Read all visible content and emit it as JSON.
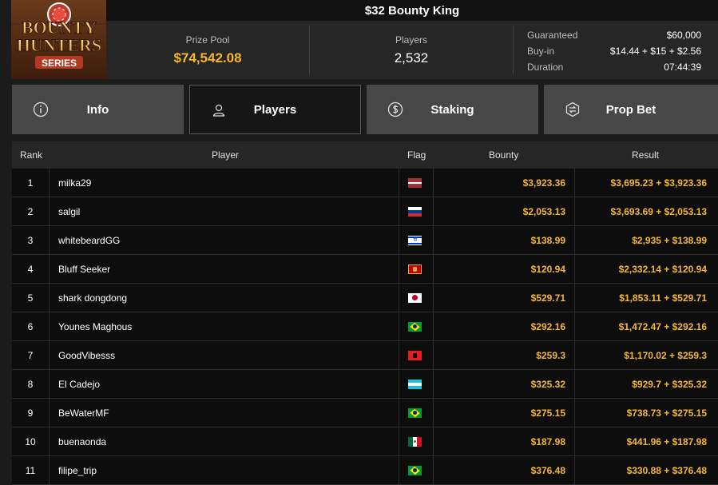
{
  "logo": {
    "line1": "BOUNTY",
    "line2": "HUNTERS",
    "line3": "SERIES"
  },
  "title": "$32 Bounty King",
  "stats": {
    "prize_pool_label": "Prize Pool",
    "prize_pool_value": "$74,542.08",
    "players_label": "Players",
    "players_value": "2,532"
  },
  "details": {
    "guaranteed_label": "Guaranteed",
    "guaranteed_value": "$60,000",
    "buyin_label": "Buy-in",
    "buyin_value": "$14.44 + $15 + $2.56",
    "duration_label": "Duration",
    "duration_value": "07:44:39"
  },
  "tabs": [
    {
      "label": "Info",
      "icon": "info-icon"
    },
    {
      "label": "Players",
      "icon": "user-icon"
    },
    {
      "label": "Staking",
      "icon": "dollar-coin-icon"
    },
    {
      "label": "Prop Bet",
      "icon": "prop-bet-icon"
    }
  ],
  "table": {
    "headers": {
      "rank": "Rank",
      "player": "Player",
      "flag": "Flag",
      "bounty": "Bounty",
      "result": "Result"
    },
    "rows": [
      {
        "rank": "1",
        "player": "milka29",
        "flag": "latvia",
        "bounty": "$3,923.36",
        "result": "$3,695.23 + $3,923.36"
      },
      {
        "rank": "2",
        "player": "salgil",
        "flag": "russia",
        "bounty": "$2,053.13",
        "result": "$3,693.69 + $2,053.13"
      },
      {
        "rank": "3",
        "player": "whitebeardGG",
        "flag": "israel",
        "bounty": "$138.99",
        "result": "$2,935 + $138.99"
      },
      {
        "rank": "4",
        "player": "Bluff Seeker",
        "flag": "montenegro",
        "bounty": "$120.94",
        "result": "$2,332.14 + $120.94"
      },
      {
        "rank": "5",
        "player": "shark dongdong",
        "flag": "japan",
        "bounty": "$529.71",
        "result": "$1,853.11 + $529.71"
      },
      {
        "rank": "6",
        "player": "Younes Maghous",
        "flag": "brazil",
        "bounty": "$292.16",
        "result": "$1,472.47 + $292.16"
      },
      {
        "rank": "7",
        "player": "GoodVibesss",
        "flag": "albania",
        "bounty": "$259.3",
        "result": "$1,170.02 + $259.3"
      },
      {
        "rank": "8",
        "player": "El Cadejo",
        "flag": "honduras",
        "bounty": "$325.32",
        "result": "$929.7 + $325.32"
      },
      {
        "rank": "9",
        "player": "BeWaterMF",
        "flag": "brazil",
        "bounty": "$275.15",
        "result": "$738.73 + $275.15"
      },
      {
        "rank": "10",
        "player": "buenaonda",
        "flag": "mexico",
        "bounty": "$187.98",
        "result": "$441.96 + $187.98"
      },
      {
        "rank": "11",
        "player": "filipe_trip",
        "flag": "brazil",
        "bounty": "$376.48",
        "result": "$330.88 + $376.48"
      }
    ]
  }
}
